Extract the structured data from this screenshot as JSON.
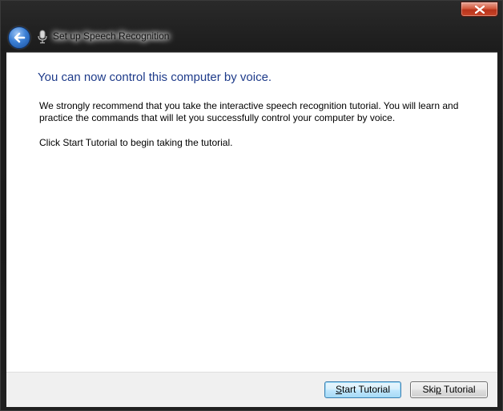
{
  "window": {
    "title": "Set up Speech Recognition"
  },
  "content": {
    "heading": "You can now control this computer by voice.",
    "paragraph1": "We strongly recommend that you take the interactive speech recognition tutorial. You will learn and practice the commands that will let you successfully control your computer by voice.",
    "paragraph2": "Click Start Tutorial to begin taking the tutorial."
  },
  "buttons": {
    "start_mnemonic": "S",
    "start_rest": "tart Tutorial",
    "skip_before": "Ski",
    "skip_mnemonic": "p",
    "skip_after": " Tutorial"
  },
  "icons": {
    "close": "close-x-icon",
    "back": "back-arrow-icon",
    "app": "microphone-icon"
  },
  "colors": {
    "heading": "#1e3b8a",
    "close_button": "#c9462a",
    "default_button_border": "#3c7fb1"
  }
}
